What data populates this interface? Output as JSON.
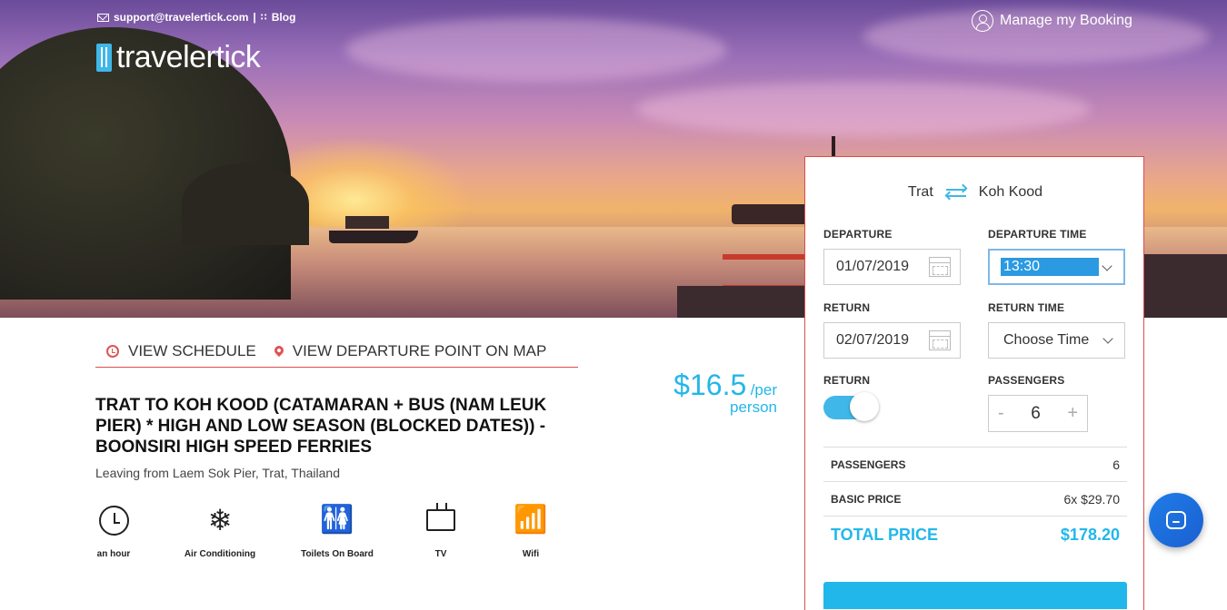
{
  "header": {
    "email": "support@travelertick.com",
    "separator": "|",
    "blog": "Blog",
    "logo_text": "travelertick",
    "manage_booking": "Manage my Booking"
  },
  "tabs": {
    "schedule": "VIEW SCHEDULE",
    "map": "VIEW DEPARTURE POINT ON MAP"
  },
  "trip": {
    "title": "TRAT TO KOH KOOD (CATAMARAN + BUS (NAM LEUK PIER) * HIGH AND LOW SEASON (BLOCKED DATES)) - BOONSIRI HIGH SPEED FERRIES",
    "leaving": "Leaving from Laem Sok Pier, Trat, Thailand",
    "price": "$16.5",
    "per": "/per",
    "person": "person"
  },
  "amenities": [
    {
      "label": "an hour",
      "icon": "clock-icon"
    },
    {
      "label": "Air Conditioning",
      "icon": "snowflake-icon"
    },
    {
      "label": "Toilets On Board",
      "icon": "toilet-icon"
    },
    {
      "label": "TV",
      "icon": "tv-icon"
    },
    {
      "label": "Wifi",
      "icon": "wifi-icon"
    }
  ],
  "booking": {
    "from": "Trat",
    "to": "Koh Kood",
    "departure_label": "DEPARTURE",
    "departure_date": "01/07/2019",
    "departure_time_label": "DEPARTURE TIME",
    "departure_time": "13:30",
    "return_label": "RETURN",
    "return_date": "02/07/2019",
    "return_time_label": "RETURN TIME",
    "return_time": "Choose Time",
    "return_toggle_label": "RETURN",
    "return_toggle_on": true,
    "passengers_label": "PASSENGERS",
    "passengers": "6",
    "minus": "-",
    "plus": "+",
    "summary": {
      "passengers_label": "PASSENGERS",
      "passengers_value": "6",
      "basic_price_label": "BASIC PRICE",
      "basic_price_value": "6x $29.70",
      "total_label": "TOTAL PRICE",
      "total_value": "$178.20"
    }
  },
  "colors": {
    "accent": "#22b7ea",
    "red_accent": "#d84e4e",
    "chat": "#1e7de8"
  }
}
